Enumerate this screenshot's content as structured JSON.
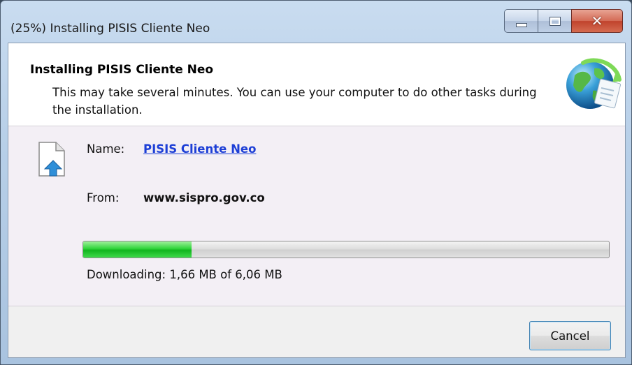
{
  "window": {
    "title": "(25%) Installing PISIS Cliente Neo"
  },
  "header": {
    "title": "Installing PISIS Cliente Neo",
    "description": "This may take several minutes. You can use your computer to do other tasks during the installation."
  },
  "details": {
    "name_label": "Name:",
    "name_value": "PISIS Cliente Neo",
    "from_label": "From:",
    "from_value": "www.sispro.gov.co"
  },
  "progress": {
    "fraction": 0.206,
    "status": "Downloading: 1,66 MB of 6,06 MB"
  },
  "buttons": {
    "cancel": "Cancel"
  },
  "icons": {
    "close": "close-icon",
    "minimize": "minimize-icon",
    "maximize": "maximize-icon",
    "globe": "globe-icon",
    "file": "file-download-icon"
  },
  "colors": {
    "link": "#1d3fd6",
    "progress": "#2fd43a",
    "close_button": "#c0432d"
  }
}
